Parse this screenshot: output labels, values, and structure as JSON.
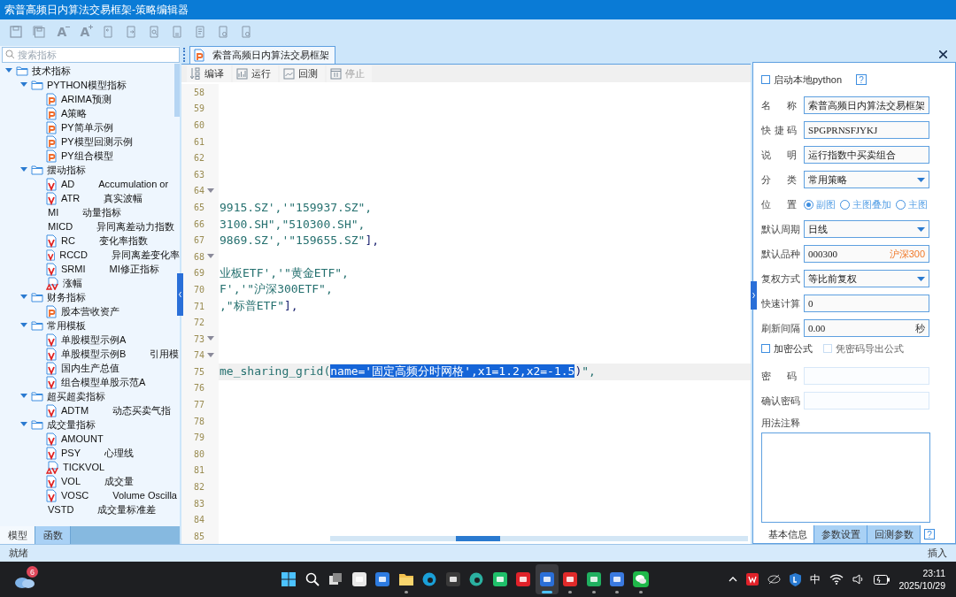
{
  "window": {
    "title": "索普高频日内算法交易框架-策略编辑器"
  },
  "toolbar": [
    {
      "kind": "save"
    },
    {
      "kind": "save-all"
    },
    {
      "kind": "font-smaller",
      "label": "A"
    },
    {
      "kind": "font-larger",
      "label": "A"
    },
    {
      "kind": "import"
    },
    {
      "kind": "export"
    },
    {
      "kind": "find"
    },
    {
      "kind": "doc-in"
    },
    {
      "kind": "doc-list"
    },
    {
      "kind": "doc-gear"
    },
    {
      "kind": "doc-gear"
    }
  ],
  "left_panel": {
    "search": {
      "placeholder": "搜索指标"
    },
    "tree": [
      {
        "kind": "folder",
        "label": "技术指标",
        "expanded": true,
        "children": [
          {
            "kind": "folder",
            "label": "PYTHON模型指标",
            "expanded": true,
            "children": [
              {
                "kind": "p",
                "label": "ARIMA预测"
              },
              {
                "kind": "p",
                "label": "A策略"
              },
              {
                "kind": "p",
                "label": "PY简单示例"
              },
              {
                "kind": "p",
                "label": "PY模型回测示例"
              },
              {
                "kind": "p",
                "label": "PY组合模型"
              }
            ]
          },
          {
            "kind": "folder",
            "label": "摆动指标",
            "expanded": true,
            "children": [
              {
                "kind": "v",
                "label": "AD",
                "desc": "Accumulation or"
              },
              {
                "kind": "v",
                "label": "ATR",
                "desc": "真实波幅"
              },
              {
                "kind": "plain",
                "label": "MI",
                "desc": "动量指标"
              },
              {
                "kind": "plain",
                "label": "MICD",
                "desc": "异同离差动力指数"
              },
              {
                "kind": "v",
                "label": "RC",
                "desc": "变化率指数"
              },
              {
                "kind": "v",
                "label": "RCCD",
                "desc": "异同离差变化率"
              },
              {
                "kind": "v",
                "label": "SRMI",
                "desc": "MI修正指标"
              },
              {
                "kind": "av",
                "label": "涨幅"
              }
            ]
          },
          {
            "kind": "folder",
            "label": "财务指标",
            "expanded": true,
            "children": [
              {
                "kind": "p",
                "label": "股本营收资产"
              }
            ]
          },
          {
            "kind": "folder",
            "label": "常用模板",
            "expanded": true,
            "children": [
              {
                "kind": "v",
                "label": "单股模型示例A"
              },
              {
                "kind": "v",
                "label": "单股模型示例B",
                "desc": "引用模"
              },
              {
                "kind": "v",
                "label": "国内生产总值"
              },
              {
                "kind": "v",
                "label": "组合模型单股示范A"
              }
            ]
          },
          {
            "kind": "folder",
            "label": "超买超卖指标",
            "expanded": true,
            "children": [
              {
                "kind": "v",
                "label": "ADTM",
                "desc": "动态买卖气指"
              }
            ]
          },
          {
            "kind": "folder",
            "label": "成交量指标",
            "expanded": true,
            "children": [
              {
                "kind": "v",
                "label": "AMOUNT"
              },
              {
                "kind": "v",
                "label": "PSY",
                "desc": "心理线"
              },
              {
                "kind": "av",
                "label": "TICKVOL"
              },
              {
                "kind": "v",
                "label": "VOL",
                "desc": "成交量"
              },
              {
                "kind": "v",
                "label": "VOSC",
                "desc": "Volume Oscilla"
              },
              {
                "kind": "plain",
                "label": "VSTD",
                "desc": "成交量标准差"
              }
            ]
          }
        ]
      }
    ],
    "tabs": [
      {
        "label": "模型",
        "selected": true
      },
      {
        "label": "函数",
        "selected": false
      }
    ]
  },
  "editor": {
    "tab": {
      "title": "索普高频日内算法交易框架"
    },
    "actions": [
      {
        "kind": "compile",
        "label": "编译",
        "disabled": false
      },
      {
        "kind": "run",
        "label": "运行",
        "disabled": false
      },
      {
        "kind": "backtest",
        "label": "回测",
        "disabled": false
      },
      {
        "kind": "stop",
        "label": "停止",
        "disabled": true
      }
    ],
    "lines": [
      {
        "number": "58",
        "fold": false,
        "current": false
      },
      {
        "number": "59",
        "fold": false,
        "current": false
      },
      {
        "number": "60",
        "fold": false,
        "current": false
      },
      {
        "number": "61",
        "fold": false,
        "current": false
      },
      {
        "number": "62",
        "fold": false,
        "current": false
      },
      {
        "number": "63",
        "fold": false,
        "current": false
      },
      {
        "number": "64",
        "fold": true,
        "current": false
      },
      {
        "number": "65",
        "fold": false,
        "current": false,
        "segments": [
          {
            "kind": "string",
            "text": "9915.SZ','\"159937.SZ\","
          }
        ]
      },
      {
        "number": "66",
        "fold": false,
        "current": false,
        "segments": [
          {
            "kind": "string",
            "text": "3100.SH\",\"510300.SH\","
          }
        ]
      },
      {
        "number": "67",
        "fold": false,
        "current": false,
        "segments": [
          {
            "kind": "string",
            "text": "9869.SZ','\"159655.SZ\""
          },
          {
            "kind": "punct",
            "text": "],"
          }
        ]
      },
      {
        "number": "68",
        "fold": true,
        "current": false
      },
      {
        "number": "69",
        "fold": false,
        "current": false,
        "segments": [
          {
            "kind": "string",
            "text": "业板ETF','\"黄金ETF\","
          }
        ]
      },
      {
        "number": "70",
        "fold": false,
        "current": false,
        "segments": [
          {
            "kind": "string",
            "text": "F','\"沪深300ETF\","
          }
        ]
      },
      {
        "number": "71",
        "fold": false,
        "current": false,
        "segments": [
          {
            "kind": "string",
            "text": ",\"标普ETF\""
          },
          {
            "kind": "punct",
            "text": "],"
          }
        ]
      },
      {
        "number": "72",
        "fold": false,
        "current": false
      },
      {
        "number": "73",
        "fold": true,
        "current": false
      },
      {
        "number": "74",
        "fold": true,
        "current": false
      },
      {
        "number": "75",
        "fold": false,
        "current": true,
        "segments": [
          {
            "kind": "string",
            "text": "me_sharing_grid("
          },
          {
            "kind": "selected",
            "text": "name='固定高频分时网格',x1=1.2,x2=-1.5"
          },
          {
            "kind": "punct",
            "text": ")"
          },
          {
            "kind": "string",
            "text": "\","
          }
        ]
      },
      {
        "number": "76",
        "fold": false,
        "current": false
      },
      {
        "number": "77",
        "fold": false,
        "current": false
      },
      {
        "number": "78",
        "fold": false,
        "current": false
      },
      {
        "number": "79",
        "fold": false,
        "current": false
      },
      {
        "number": "80",
        "fold": false,
        "current": false
      },
      {
        "number": "81",
        "fold": false,
        "current": false
      },
      {
        "number": "82",
        "fold": false,
        "current": false
      },
      {
        "number": "83",
        "fold": false,
        "current": false
      },
      {
        "number": "84",
        "fold": false,
        "current": false
      },
      {
        "number": "85",
        "fold": false,
        "current": false
      }
    ]
  },
  "right_panel": {
    "local_python": {
      "label": "启动本地python",
      "checked": false,
      "help": "?"
    },
    "fields": [
      {
        "kind": "text",
        "label": "名称",
        "value": "索普高频日内算法交易框架"
      },
      {
        "kind": "text",
        "label": "快捷码",
        "value": "SPGPRNSFJYKJ"
      },
      {
        "kind": "text",
        "label": "说明",
        "value": "运行指数中买卖组合"
      },
      {
        "kind": "select",
        "label": "分类",
        "value": "常用策略"
      },
      {
        "kind": "radio",
        "label": "位置",
        "options": [
          {
            "label": "副图",
            "selected": true
          },
          {
            "label": "主图叠加",
            "selected": false
          },
          {
            "label": "主图",
            "selected": false
          }
        ]
      },
      {
        "kind": "select",
        "label": "默认周期",
        "value": "日线"
      },
      {
        "kind": "text",
        "label": "默认品种",
        "value": "000300",
        "suffix": {
          "text": "沪深300",
          "highlight": true
        }
      },
      {
        "kind": "select",
        "label": "复权方式",
        "value": "等比前复权"
      },
      {
        "kind": "text",
        "label": "快速计算",
        "value": "0"
      },
      {
        "kind": "text",
        "label": "刷新间隔",
        "value": "0.00",
        "suffix": {
          "text": "秒",
          "highlight": false
        }
      }
    ],
    "options": [
      {
        "label": "加密公式",
        "checked": false,
        "disabled": false
      },
      {
        "label": "凭密码导出公式",
        "checked": false,
        "disabled": true
      }
    ],
    "passwords": [
      {
        "label": "密码",
        "disabled": true
      },
      {
        "label": "确认密码",
        "disabled": true
      }
    ],
    "notes": {
      "label": "用法注释"
    },
    "tabs": [
      {
        "label": "基本信息",
        "selected": true
      },
      {
        "label": "参数设置",
        "selected": false
      },
      {
        "label": "回测参数",
        "selected": false
      }
    ],
    "help": "?"
  },
  "status_bar": {
    "message": "就绪",
    "mode": "插入"
  },
  "taskbar": {
    "weather_badge": "6",
    "apps": [
      {
        "kind": "start",
        "running": false,
        "selected": false
      },
      {
        "kind": "search",
        "running": false,
        "selected": false
      },
      {
        "kind": "taskview",
        "running": false,
        "selected": false
      },
      {
        "kind": "store",
        "running": false,
        "selected": false
      },
      {
        "kind": "mail",
        "running": false,
        "selected": false
      },
      {
        "kind": "folder",
        "running": true,
        "selected": false
      },
      {
        "kind": "edge",
        "running": false,
        "selected": false
      },
      {
        "kind": "cube",
        "running": false,
        "selected": false
      },
      {
        "kind": "edge-dev",
        "running": false,
        "selected": false
      },
      {
        "kind": "green-app",
        "running": false,
        "selected": false
      },
      {
        "kind": "wps",
        "running": false,
        "selected": false
      },
      {
        "kind": "st-app",
        "running": true,
        "selected": true
      },
      {
        "kind": "red-app",
        "running": true,
        "selected": false
      },
      {
        "kind": "monitor-app",
        "running": true,
        "selected": false
      },
      {
        "kind": "blue-app",
        "running": true,
        "selected": false
      },
      {
        "kind": "chat",
        "running": true,
        "selected": false
      }
    ],
    "tray": {
      "ime": "中",
      "time": "23:11",
      "date": "2025/10/29"
    }
  }
}
